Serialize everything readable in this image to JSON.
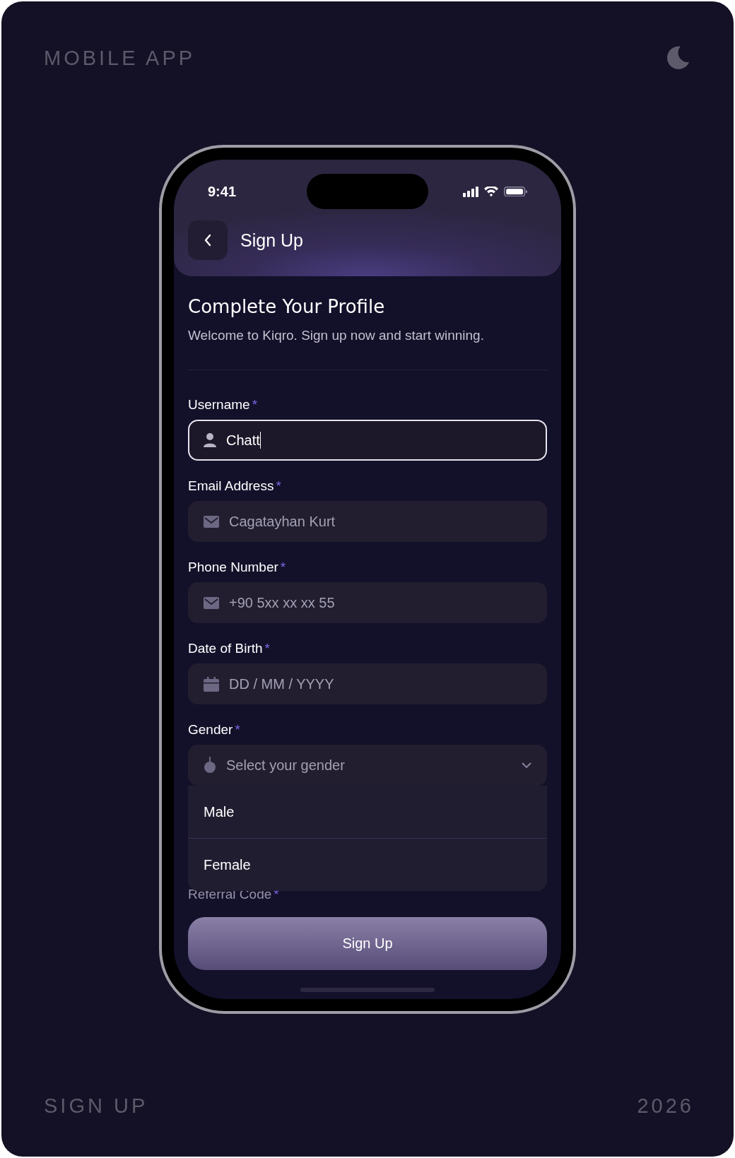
{
  "header_label": "MOBILE APP",
  "footer_label": "SIGN UP",
  "year": "2026",
  "status_bar": {
    "time": "9:41"
  },
  "nav": {
    "title": "Sign Up"
  },
  "intro": {
    "title": "Complete Your Profile",
    "subtitle": "Welcome to Kiqro. Sign up now and start winning."
  },
  "fields": [
    {
      "kind": "text",
      "label": "Username",
      "required": "*",
      "value": "Chatt",
      "focused": true
    },
    {
      "kind": "text",
      "label": "Email Address",
      "required": "*",
      "placeholder": "Cagatayhan Kurt",
      "focused": false
    },
    {
      "kind": "text",
      "label": "Phone Number",
      "required": "*",
      "placeholder": "+90 5xx xx xx 55",
      "focused": false
    },
    {
      "kind": "text",
      "label": "Date of Birth",
      "required": "*",
      "placeholder": "DD / MM / YYYY",
      "focused": false
    },
    {
      "kind": "select",
      "label": "Gender",
      "required": "*",
      "placeholder": "Select your gender",
      "focused": false,
      "expanded": true,
      "options": [
        {
          "label": "Male",
          "selected": false
        },
        {
          "label": "Female",
          "selected": false
        }
      ]
    }
  ],
  "referral": {
    "label": "Referral Code",
    "required": "*"
  },
  "submit": {
    "label": "Sign Up"
  }
}
